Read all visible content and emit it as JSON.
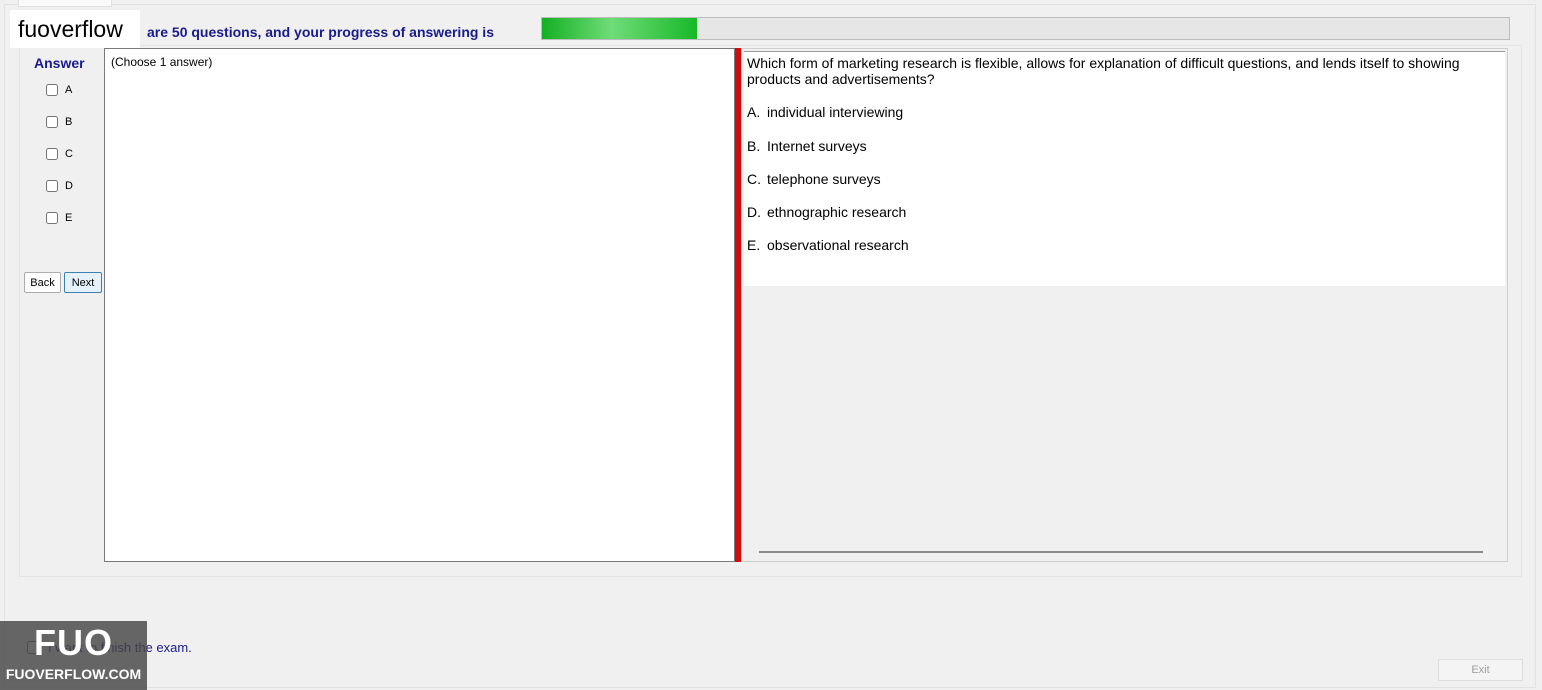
{
  "brand": {
    "label": "fuoverflow"
  },
  "progress": {
    "text": "are 50 questions, and your progress of answering is",
    "fraction": 0.16
  },
  "answer_panel": {
    "heading": "Answer",
    "choices": [
      "A",
      "B",
      "C",
      "D",
      "E"
    ],
    "back_label": "Back",
    "next_label": "Next",
    "hint": "(Choose 1 answer)"
  },
  "question": {
    "text": "Which form of marketing research is flexible, allows for explanation of difficult questions, and lends itself to showing products and advertisements?",
    "options": [
      {
        "letter": "A.",
        "text": "individual interviewing"
      },
      {
        "letter": "B.",
        "text": "Internet surveys"
      },
      {
        "letter": "C.",
        "text": "telephone surveys"
      },
      {
        "letter": "D.",
        "text": "ethnographic research"
      },
      {
        "letter": "E.",
        "text": "observational research"
      }
    ]
  },
  "footer": {
    "finish_label": "I want to finish the exam.",
    "exit_label": "Exit"
  },
  "logo": {
    "main": "FUO",
    "sub": "FUOVERFLOW.COM"
  },
  "colors": {
    "accent_text": "#1a1a8c",
    "splitter": "#d10c0c",
    "progress_fill": "#14b024"
  }
}
